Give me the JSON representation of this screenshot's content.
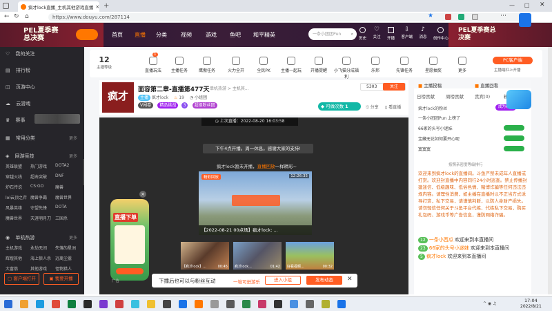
{
  "browser": {
    "tab_title": "疯才lock直播_主机其他游戏直播",
    "url": "https://www.douyu.com/287114",
    "new_tab": "+"
  },
  "header": {
    "banner_left": "PEL夏季赛总决赛",
    "nav": [
      "首页",
      "直播",
      "分类",
      "视频",
      "游戏",
      "鱼吧",
      "和平精英"
    ],
    "search_placeholder": "一条小团团Pun",
    "banner_right": "PEL夏季赛总决赛",
    "actions": [
      {
        "label": "历史",
        "icon": "history-icon"
      },
      {
        "label": "关注",
        "icon": "heart-icon"
      },
      {
        "label": "开播",
        "icon": "broadcast-icon"
      },
      {
        "label": "客户端",
        "icon": "download-icon"
      },
      {
        "label": "消息",
        "icon": "bell-icon"
      },
      {
        "label": "创作中心",
        "icon": "user-icon"
      }
    ]
  },
  "sidebar": {
    "top_items": [
      "我的关注",
      "排行榜",
      "页游中心",
      "云游戏",
      "赛事"
    ],
    "common_title": "常用分类",
    "common_more": "更多",
    "net_title": "网游竞技",
    "net_more": "更多",
    "net_grid": [
      "英雄联盟",
      "热门游戏",
      "DOTA2",
      "穿越火线",
      "超击突破",
      "DNF",
      "炉石传说",
      "CS:GO",
      "魔兽",
      "lol云顶之弈",
      "魔兽争霸",
      "魔兽世界",
      "风暴英雄",
      "守望先锋",
      "DOTA",
      "魔兽世界",
      "天涯明月刀",
      "三国杀"
    ],
    "single_title": "单机热游",
    "single_more": "更多",
    "single_grid": [
      "主机游戏",
      "永劫无间",
      "失落的星洲",
      "辉煌其他",
      "海上狼人杀",
      "远离尘嚣",
      "大富翁",
      "其他游戏",
      "怪物猎人"
    ],
    "btn_client": "客户端打开",
    "btn_live": "我要开播"
  },
  "toolbar": {
    "level": "12",
    "level_label": "主播等级",
    "badge": "1",
    "items": [
      "直播玩法",
      "主播任务",
      "鹰傲任务",
      "火力全开",
      "全民PK",
      "主播一起玩",
      "开播提醒",
      "小飞猫分成福利",
      "乐邦",
      "先锋任务",
      "星愿抽奖",
      "更多"
    ],
    "pc_btn": "PC客户端",
    "pc_sub": "主播端杠上开播"
  },
  "streamer": {
    "avatar_text": "疯才",
    "title": "面容第二章-直播第477天",
    "category": "单机热游 > 主机其...",
    "name": "疯才lock",
    "fans": "19",
    "report": "小组团",
    "tags": [
      "V闯卷",
      "精品挑战",
      "3",
      "超级粉丝团"
    ],
    "follow_count": "5303",
    "follow_label": "关注",
    "gift_label": "可做次数",
    "gift_count": "1",
    "share": "分享",
    "mobile": "看直播"
  },
  "video": {
    "last_live": "上次直播：2022-08-20 16:03:58",
    "notice": "下午4点开播。周一休息。感谢大家的支持!",
    "sub_notice_prefix": "疯才lock暂未开播，",
    "sub_notice_link": "直播回放",
    "sub_notice_suffix": "一样精彩~",
    "replay_tag": "精彩回放",
    "replay_time": "12:26:35",
    "replay_caption": "【2022-08-21 00点场】疯才lock: ...",
    "thumb_captions": [
      "【疯才lock】...",
      "疯才lock...",
      "好看视频..."
    ],
    "thumb_times": [
      "00:45",
      "01:42",
      "00:32"
    ],
    "float_banner": "直播下单",
    "ad_label": "广告",
    "bottom_prompt": "下播后也可以与粉丝互动",
    "bottom_link": "一堆可进游乐",
    "bottom_btn1": "进入小组",
    "bottom_btn2": "发布动态"
  },
  "right_panel": {
    "tab1": "主播投稿",
    "tab2": "直播回看",
    "sub_tabs": [
      "日榜贡献",
      "周榜贡献",
      "贵宾(0)",
      "粉丝团"
    ],
    "rank_header": "疯才lock的粉丝",
    "rank_btn": "成为粉丝",
    "rank_items": [
      "一条小团团Pun 上榜了",
      "66家的头号小迷妹",
      "宝藏无论如何要开心呢",
      "寞寞寞"
    ],
    "rank_footer": "按照亲密度等级排行",
    "welcome": "欢迎来到疯才lock的直播间。斗鱼严禁未成年人直播或打赏。欢迎封直播中内容同行24小时巡查。禁止传播封建迷信、低级趣味、低俗色情、赌博诈骗等任何违法违规内容。请理性消费，如主播在直播时以不正当方式诱导打赏，私下交易，请谨慎判断，以防人身财产损失。请勿轻信任何关于斗鱼平台代练、代练私下交易，购买礼包码、游戏币等广告信息，谨防网络诈骗。",
    "chat": [
      {
        "level": "12",
        "name": "一条小西瓜",
        "text": "欢迎来到本直播间"
      },
      {
        "level": "23",
        "name": "66家的头号小迷妹",
        "text": "欢迎来到本直播间"
      },
      {
        "level": "5",
        "name": "疯才lock",
        "text": "欢迎来到本直播间"
      }
    ]
  },
  "taskbar": {
    "time": "17:04",
    "date": "2022/8/21"
  },
  "colors": {
    "accent": "#ff5d23",
    "douyu_orange": "#ff7700",
    "dark_sidebar": "#26252a",
    "video_bg": "#2b2b2b"
  }
}
